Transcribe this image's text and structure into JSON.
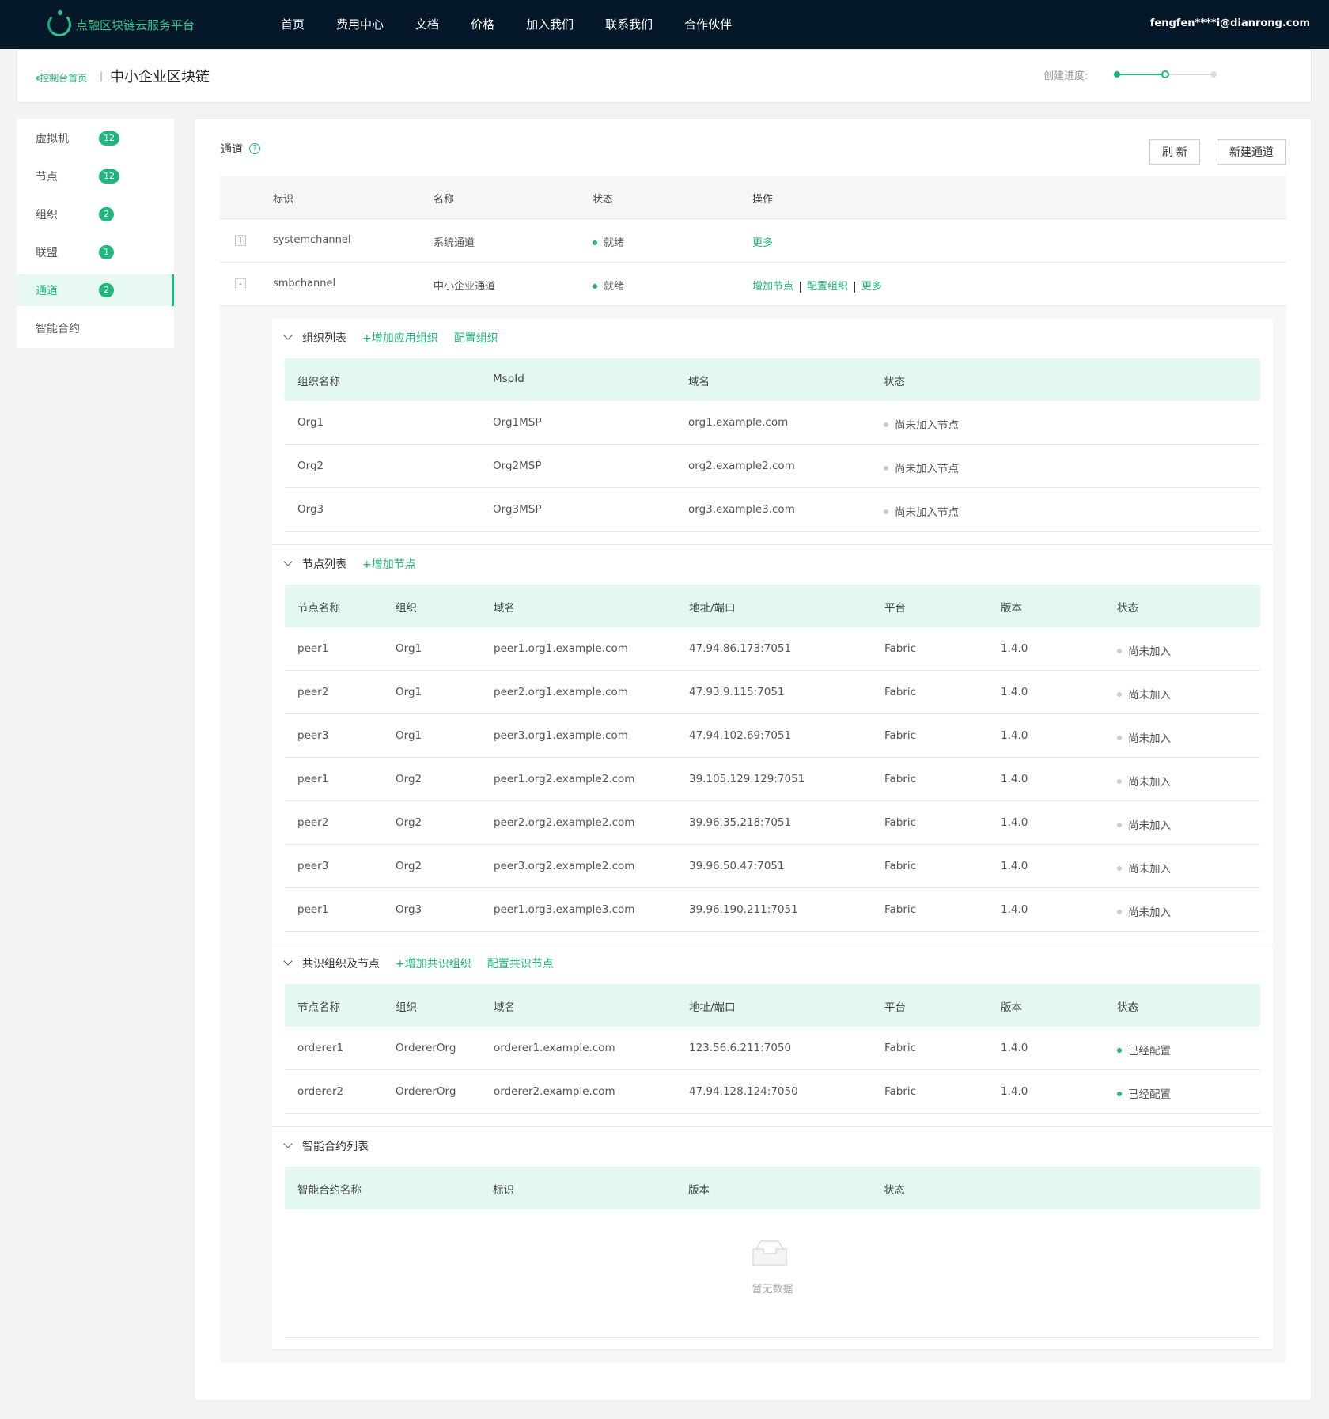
{
  "topbar": {
    "brand": "点融区块链云服务平台",
    "nav": [
      "首页",
      "费用中心",
      "文档",
      "价格",
      "加入我们",
      "联系我们",
      "合作伙伴"
    ],
    "user": "fengfen****i@dianrong.com"
  },
  "breadcrumb": {
    "back": "控制台首页",
    "separator": "|",
    "title": "中小企业区块链",
    "progress_label": "创建进度:",
    "progress_fraction": 0.5
  },
  "sidebar": {
    "items": [
      {
        "label": "虚拟机",
        "count": "12"
      },
      {
        "label": "节点",
        "count": "12"
      },
      {
        "label": "组织",
        "count": "2"
      },
      {
        "label": "联盟",
        "count": "1"
      },
      {
        "label": "通道",
        "count": "2"
      },
      {
        "label": "智能合约",
        "count": ""
      }
    ],
    "active_index": 4
  },
  "main": {
    "title": "通道",
    "help_icon": "?",
    "refresh": "刷 新",
    "new_channel": "新建通道",
    "columns": [
      "标识",
      "名称",
      "状态",
      "操作"
    ],
    "rows": [
      {
        "expander": "+",
        "id": "systemchannel",
        "name": "系统通道",
        "status": "就绪",
        "actions": [
          "更多"
        ]
      },
      {
        "expander": "-",
        "id": "smbchannel",
        "name": "中小企业通道",
        "status": "就绪",
        "actions": [
          "增加节点",
          "配置组织",
          "更多"
        ]
      }
    ]
  },
  "org_section": {
    "title": "组织列表",
    "links": [
      "+增加应用组织",
      "配置组织"
    ],
    "columns": [
      "组织名称",
      "MspId",
      "域名",
      "状态"
    ],
    "rows": [
      [
        "Org1",
        "Org1MSP",
        "org1.example.com",
        "尚未加入节点"
      ],
      [
        "Org2",
        "Org2MSP",
        "org2.example2.com",
        "尚未加入节点"
      ],
      [
        "Org3",
        "Org3MSP",
        "org3.example3.com",
        "尚未加入节点"
      ]
    ]
  },
  "peer_section": {
    "title": "节点列表",
    "links": [
      "+增加节点"
    ],
    "columns": [
      "节点名称",
      "组织",
      "域名",
      "地址/端口",
      "平台",
      "版本",
      "状态"
    ],
    "rows": [
      [
        "peer1",
        "Org1",
        "peer1.org1.example.com",
        "47.94.86.173:7051",
        "Fabric",
        "1.4.0",
        "尚未加入"
      ],
      [
        "peer2",
        "Org1",
        "peer2.org1.example.com",
        "47.93.9.115:7051",
        "Fabric",
        "1.4.0",
        "尚未加入"
      ],
      [
        "peer3",
        "Org1",
        "peer3.org1.example.com",
        "47.94.102.69:7051",
        "Fabric",
        "1.4.0",
        "尚未加入"
      ],
      [
        "peer1",
        "Org2",
        "peer1.org2.example2.com",
        "39.105.129.129:7051",
        "Fabric",
        "1.4.0",
        "尚未加入"
      ],
      [
        "peer2",
        "Org2",
        "peer2.org2.example2.com",
        "39.96.35.218:7051",
        "Fabric",
        "1.4.0",
        "尚未加入"
      ],
      [
        "peer3",
        "Org2",
        "peer3.org2.example2.com",
        "39.96.50.47:7051",
        "Fabric",
        "1.4.0",
        "尚未加入"
      ],
      [
        "peer1",
        "Org3",
        "peer1.org3.example3.com",
        "39.96.190.211:7051",
        "Fabric",
        "1.4.0",
        "尚未加入"
      ]
    ]
  },
  "orderer_section": {
    "title": "共识组织及节点",
    "links": [
      "+增加共识组织",
      "配置共识节点"
    ],
    "columns": [
      "节点名称",
      "组织",
      "域名",
      "地址/端口",
      "平台",
      "版本",
      "状态"
    ],
    "rows": [
      [
        "orderer1",
        "OrdererOrg",
        "orderer1.example.com",
        "123.56.6.211:7050",
        "Fabric",
        "1.4.0",
        "已经配置"
      ],
      [
        "orderer2",
        "OrdererOrg",
        "orderer2.example.com",
        "47.94.128.124:7050",
        "Fabric",
        "1.4.0",
        "已经配置"
      ]
    ]
  },
  "contract_section": {
    "title": "智能合约列表",
    "columns": [
      "智能合约名称",
      "标识",
      "版本",
      "状态"
    ],
    "empty_text": "暂无数据",
    "empty_icon": "inbox-icon"
  },
  "colors": {
    "accent": "#1fb67d",
    "topbar": "#05182a",
    "table_header": "#e3f9ef"
  }
}
